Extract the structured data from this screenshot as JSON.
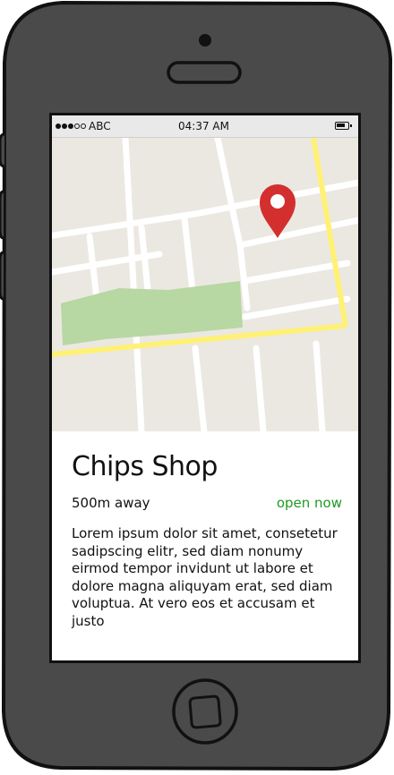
{
  "status_bar": {
    "carrier": "ABC",
    "time": "04:37 AM",
    "signal_bars_filled": 3,
    "signal_bars_total": 5
  },
  "map": {
    "pin_color": "#d32f2f",
    "road_color": "#fff176",
    "park_color": "#b7d7a3"
  },
  "place": {
    "name": "Chips Shop",
    "distance": "500m away",
    "status": "open now",
    "status_color": "#1e9b23",
    "description": "Lorem ipsum dolor sit amet, consetetur sadipscing elitr, sed diam nonumy eirmod tempor invidunt ut labore et dolore magna aliquyam erat, sed diam voluptua. At vero eos et accusam et justo"
  },
  "icons": {
    "home_button": "home-button-icon",
    "speaker": "speaker-icon",
    "camera": "camera-icon",
    "battery": "battery-icon",
    "map_pin": "map-pin-icon"
  }
}
